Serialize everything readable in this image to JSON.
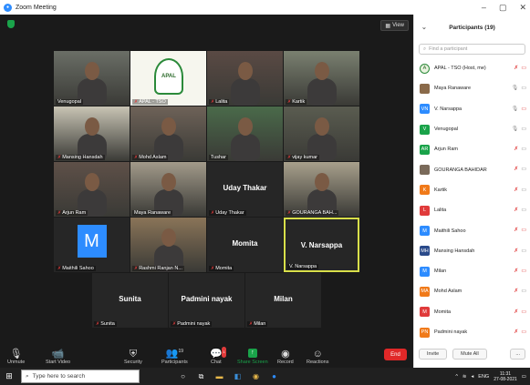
{
  "window": {
    "title": "Zoom Meeting"
  },
  "meeting": {
    "view_label": "View",
    "tiles": [
      {
        "name": "Venugopal",
        "muted": false,
        "type": "video"
      },
      {
        "name": "APAL - TSO",
        "muted": true,
        "type": "logo",
        "logo_text": "APAL"
      },
      {
        "name": "Lalita",
        "muted": true,
        "type": "video"
      },
      {
        "name": "Kartik",
        "muted": true,
        "type": "video"
      },
      {
        "name": "Mansing Hansdah",
        "muted": true,
        "type": "video"
      },
      {
        "name": "Mohd Aslam",
        "muted": true,
        "type": "video"
      },
      {
        "name": "Tushar",
        "muted": false,
        "type": "video"
      },
      {
        "name": "vijay kumar",
        "muted": true,
        "type": "video"
      },
      {
        "name": "Arjun Ram",
        "muted": true,
        "type": "video"
      },
      {
        "name": "Maya Ranaware",
        "muted": false,
        "type": "video"
      },
      {
        "name": "Uday Thakar",
        "muted": true,
        "type": "name",
        "center_name": "Uday Thakar"
      },
      {
        "name": "GOURANGA BAH...",
        "muted": true,
        "type": "video"
      },
      {
        "name": "Maithili Sahoo",
        "muted": true,
        "type": "avatar",
        "initial": "M"
      },
      {
        "name": "Rashmi Ranjan N...",
        "muted": true,
        "type": "video"
      },
      {
        "name": "Momita",
        "muted": true,
        "type": "name",
        "center_name": "Momita"
      },
      {
        "name": "V. Narsappa",
        "muted": false,
        "type": "name",
        "center_name": "V. Narsappa",
        "active": true
      },
      {
        "name": "Sunita",
        "muted": true,
        "type": "name",
        "center_name": "Sunita"
      },
      {
        "name": "Padmini nayak",
        "muted": true,
        "type": "name",
        "center_name": "Padmini nayak"
      },
      {
        "name": "Milan",
        "muted": true,
        "type": "name",
        "center_name": "Milan"
      }
    ]
  },
  "toolbar": {
    "unmute": "Unmute",
    "start_video": "Start Video",
    "security": "Security",
    "participants": "Participants",
    "participants_count": "19",
    "chat": "Chat",
    "chat_badge": "1",
    "share_screen": "Share Screen",
    "record": "Record",
    "reactions": "Reactions",
    "end": "End"
  },
  "panel": {
    "title": "Participants (19)",
    "search_placeholder": "Find a participant",
    "participants": [
      {
        "name": "APAL - TSO (Host, me)",
        "initials": "A",
        "color": "#e9f3df",
        "mic_on": false,
        "video_on": false
      },
      {
        "name": "Maya Ranaware",
        "initials": "",
        "color": "#8a6a4a",
        "mic_on": true,
        "video_on": true
      },
      {
        "name": "V. Narsappa",
        "initials": "VN",
        "color": "#2d8cff",
        "mic_on": true,
        "video_on": false
      },
      {
        "name": "Venugopal",
        "initials": "V",
        "color": "#1aa34a",
        "mic_on": true,
        "video_on": true
      },
      {
        "name": "Arjun Ram",
        "initials": "AR",
        "color": "#1aa34a",
        "mic_on": false,
        "video_on": true
      },
      {
        "name": "GOURANGA BAHIDAR",
        "initials": "",
        "color": "#7a6a5a",
        "mic_on": false,
        "video_on": true
      },
      {
        "name": "Kartik",
        "initials": "K",
        "color": "#f07a1a",
        "mic_on": false,
        "video_on": true
      },
      {
        "name": "Lalita",
        "initials": "L",
        "color": "#e03b3b",
        "mic_on": false,
        "video_on": true
      },
      {
        "name": "Maithili Sahoo",
        "initials": "M",
        "color": "#2d8cff",
        "mic_on": false,
        "video_on": false
      },
      {
        "name": "Mansing Hansdah",
        "initials": "MH",
        "color": "#2a4a8a",
        "mic_on": false,
        "video_on": true
      },
      {
        "name": "Milan",
        "initials": "M",
        "color": "#2d8cff",
        "mic_on": false,
        "video_on": false
      },
      {
        "name": "Mohd Aslam",
        "initials": "MA",
        "color": "#f07a1a",
        "mic_on": false,
        "video_on": true
      },
      {
        "name": "Momita",
        "initials": "M",
        "color": "#e03b3b",
        "mic_on": false,
        "video_on": false
      },
      {
        "name": "Padmini nayak",
        "initials": "PN",
        "color": "#f07a1a",
        "mic_on": false,
        "video_on": false
      }
    ],
    "invite": "Invite",
    "mute_all": "Mute All",
    "more": "..."
  },
  "taskbar": {
    "search_placeholder": "Type here to search",
    "lang": "ENG",
    "time": "11:31",
    "date": "27-08-2021"
  }
}
